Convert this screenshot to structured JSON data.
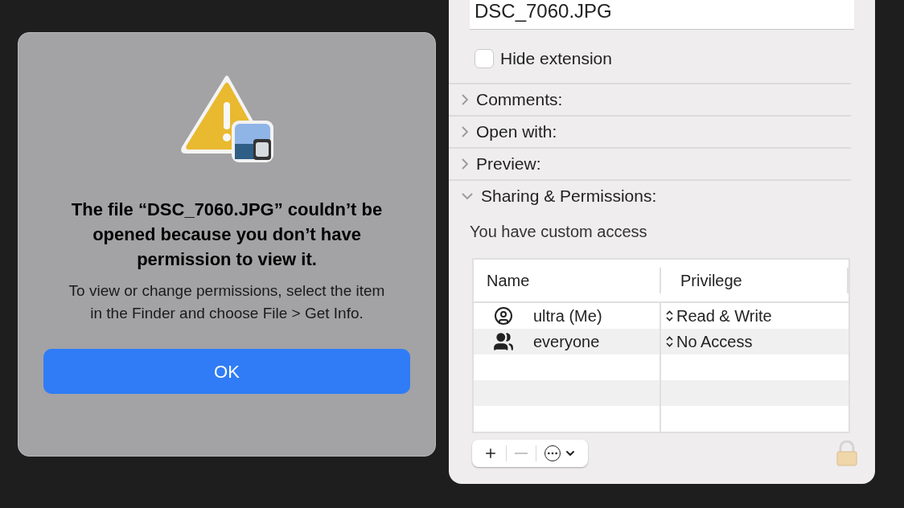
{
  "alert": {
    "title": "The file “DSC_7060.JPG” couldn’t be opened because you don’t have permission to view it.",
    "message": "To view or change permissions, select the item in the Finder and choose File > Get Info.",
    "buttons": [
      {
        "label": "OK",
        "default": true
      }
    ]
  },
  "info": {
    "filename": "DSC_7060.JPG",
    "hide_extension": {
      "label": "Hide extension",
      "checked": false
    },
    "sections": [
      {
        "label": "Comments:",
        "expanded": false
      },
      {
        "label": "Open with:",
        "expanded": false
      },
      {
        "label": "Preview:",
        "expanded": false
      },
      {
        "label": "Sharing & Permissions:",
        "expanded": true
      }
    ],
    "access_note": "You have custom access",
    "table": {
      "columns": [
        "Name",
        "Privilege"
      ],
      "rows": [
        {
          "kind": "user",
          "name": "ultra (Me)",
          "privilege": "Read & Write"
        },
        {
          "kind": "group",
          "name": "everyone",
          "privilege": "No Access"
        }
      ]
    },
    "toolbar": [
      {
        "kind": "add",
        "disabled": false
      },
      {
        "kind": "remove",
        "disabled": true
      },
      {
        "kind": "action",
        "disabled": false
      }
    ]
  }
}
